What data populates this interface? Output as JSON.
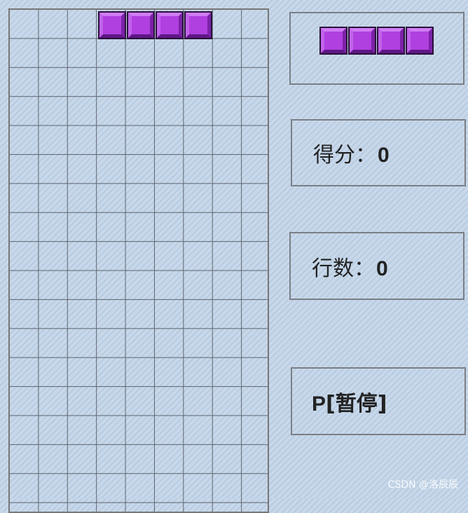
{
  "board": {
    "columns": 9,
    "active_piece": {
      "shape": "I",
      "orientation": "horizontal",
      "color": "#b040e0",
      "cells": 4
    }
  },
  "preview": {
    "shape": "I",
    "color": "#b040e0",
    "cells": 4
  },
  "score": {
    "label": "得分",
    "separator": "：",
    "value": "0"
  },
  "lines": {
    "label": "行数",
    "separator": "：",
    "value": "0"
  },
  "pause": {
    "key": "P",
    "text": "[暂停]"
  },
  "watermark": "CSDN @洛辰辰",
  "colors": {
    "background": "#c9d9ea",
    "grid_line": "#5d6570",
    "piece": "#b040e0",
    "panel_border": "#7b7f85"
  }
}
